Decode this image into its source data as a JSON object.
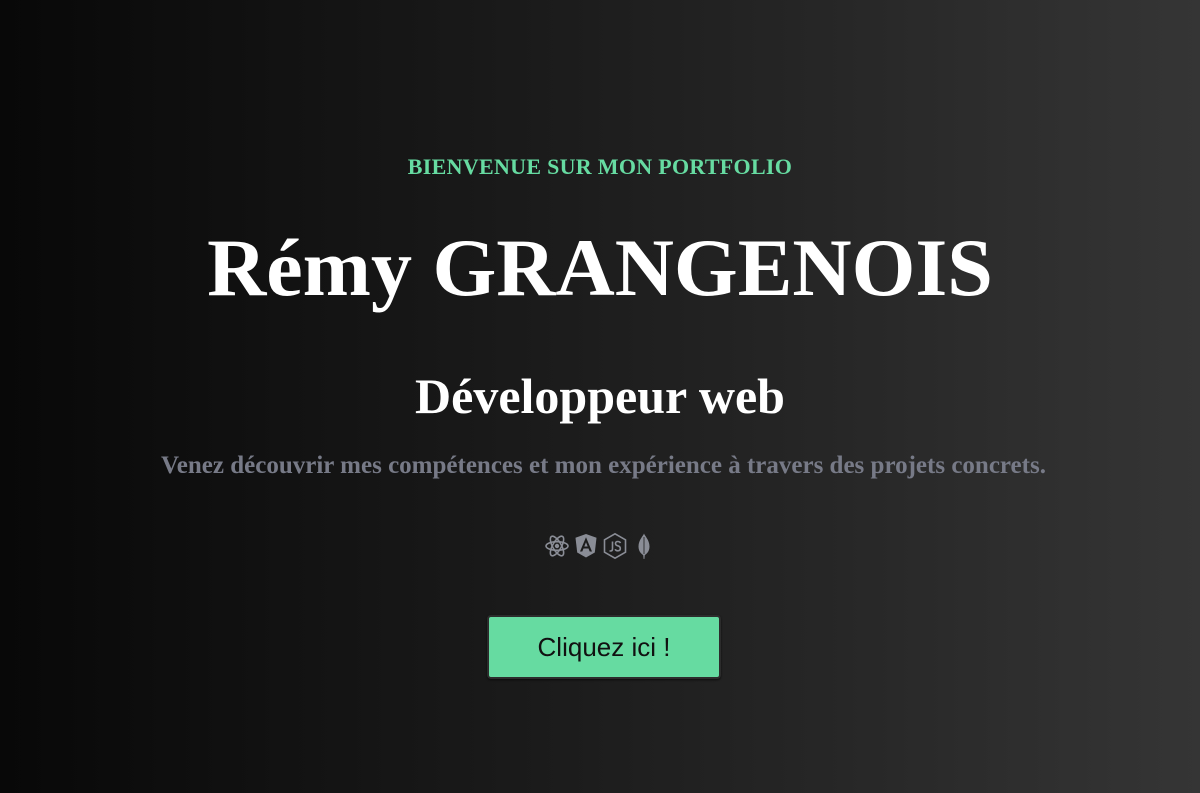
{
  "hero": {
    "welcome": "BIENVENUE SUR MON PORTFOLIO",
    "name": "Rémy GRANGENOIS",
    "role": "Développeur web",
    "description": "Venez découvrir mes compétences et mon expérience à travers des projets concrets.",
    "tech_icons": [
      "react-icon",
      "angular-icon",
      "nodejs-icon",
      "mongodb-icon"
    ],
    "cta_label": "Cliquez ici !"
  },
  "colors": {
    "accent": "#66dba1",
    "heading": "#ffffff",
    "muted": "#777a87",
    "button_bg": "#66dba1",
    "icon": "#8a8d96"
  }
}
